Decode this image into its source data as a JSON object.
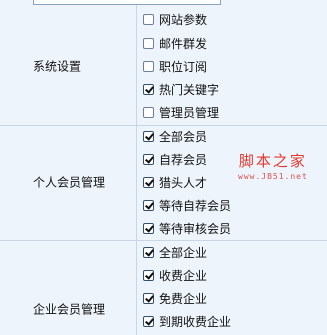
{
  "sections": [
    {
      "label": "系统设置",
      "options": [
        {
          "label": "网站参数",
          "checked": false
        },
        {
          "label": "邮件群发",
          "checked": false
        },
        {
          "label": "职位订阅",
          "checked": false
        },
        {
          "label": "热门关键字",
          "checked": true
        },
        {
          "label": "管理员管理",
          "checked": false
        }
      ]
    },
    {
      "label": "个人会员管理",
      "options": [
        {
          "label": "全部会员",
          "checked": true
        },
        {
          "label": "自荐会员",
          "checked": true
        },
        {
          "label": "猎头人才",
          "checked": true
        },
        {
          "label": "等待自荐会员",
          "checked": true
        },
        {
          "label": "等待审核会员",
          "checked": true
        }
      ]
    },
    {
      "label": "企业会员管理",
      "options": [
        {
          "label": "全部企业",
          "checked": true
        },
        {
          "label": "收费企业",
          "checked": true
        },
        {
          "label": "免费企业",
          "checked": true
        },
        {
          "label": "到期收费企业",
          "checked": true
        }
      ]
    }
  ],
  "watermark": {
    "title": "脚本之家",
    "url": "www.JB51.net"
  }
}
